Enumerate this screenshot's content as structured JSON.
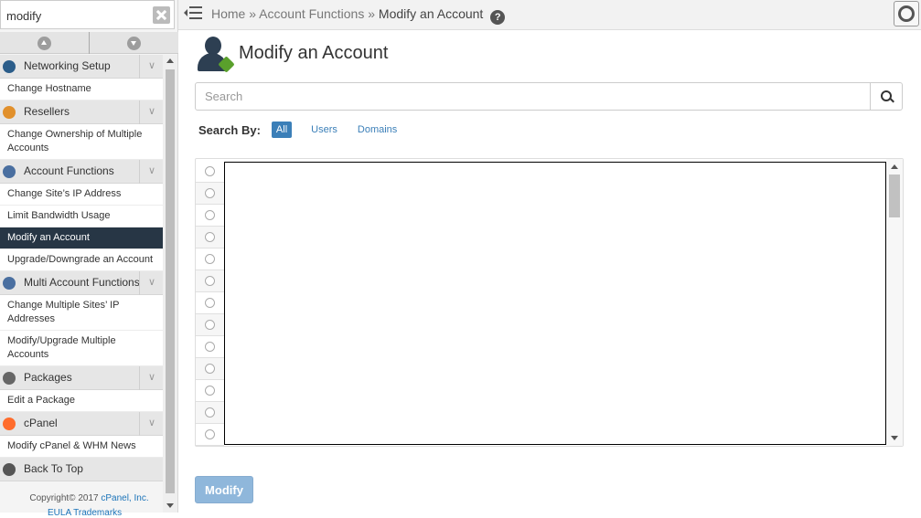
{
  "sidebar": {
    "search_value": "modify",
    "categories": [
      {
        "label": "Networking Setup",
        "color": "#2b5d8a",
        "items": [
          "Change Hostname"
        ]
      },
      {
        "label": "Resellers",
        "color": "#e1902c",
        "items": [
          "Change Ownership of Multiple Accounts"
        ]
      },
      {
        "label": "Account Functions",
        "color": "#4a6fa0",
        "items": [
          "Change Site’s IP Address",
          "Limit Bandwidth Usage",
          "Modify an Account",
          "Upgrade/Downgrade an Account"
        ]
      },
      {
        "label": "Multi Account Functions",
        "color": "#4a6fa0",
        "items": [
          "Change Multiple Sites’ IP Addresses",
          "Modify/Upgrade Multiple Accounts"
        ]
      },
      {
        "label": "Packages",
        "color": "#666666",
        "items": [
          "Edit a Package"
        ]
      },
      {
        "label": "cPanel",
        "color": "#ff6c2c",
        "items": [
          "Modify cPanel & WHM News"
        ]
      }
    ],
    "active_item": "Modify an Account",
    "back_to_top": "Back To Top",
    "copyright_prefix": "Copyright© 2017",
    "copyright_link": "cPanel, Inc.",
    "footer_links": "EULA   Trademarks"
  },
  "header": {
    "breadcrumb": [
      {
        "label": "Home"
      },
      {
        "label": "Account Functions"
      },
      {
        "label": "Modify an Account"
      }
    ],
    "separator": "»",
    "help_icon": "?"
  },
  "main": {
    "title": "Modify an Account",
    "search_placeholder": "Search",
    "search_by_label": "Search By:",
    "search_by_options": [
      "All",
      "Users",
      "Domains"
    ],
    "search_by_selected": "All",
    "modify_button": "Modify",
    "accent_color": "#3b7fb8"
  }
}
